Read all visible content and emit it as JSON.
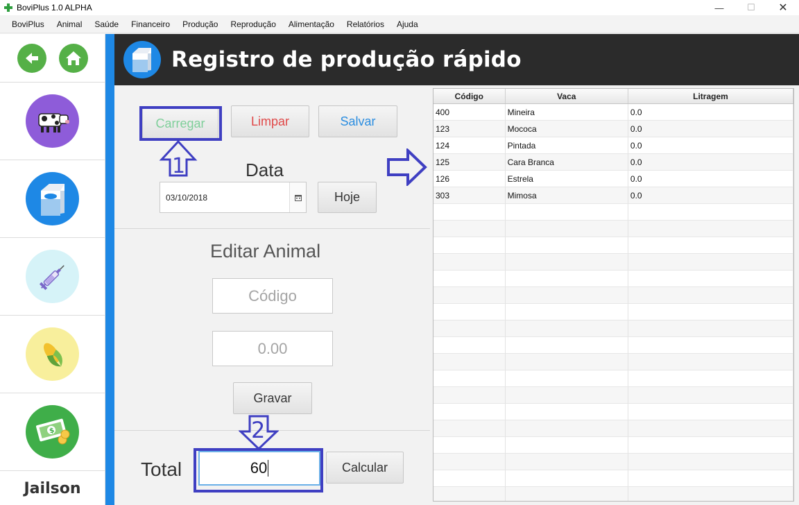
{
  "window": {
    "title": "BoviPlus 1.0 ALPHA"
  },
  "menu": [
    "BoviPlus",
    "Animal",
    "Saúde",
    "Financeiro",
    "Produção",
    "Reprodução",
    "Alimentação",
    "Relatórios",
    "Ajuda"
  ],
  "sidebar": {
    "back_icon": "arrow-left-icon",
    "home_icon": "home-icon",
    "items": [
      {
        "name": "cow",
        "icon": "cow-icon",
        "color": "#8e5cd9"
      },
      {
        "name": "milk",
        "icon": "milk-carton-icon",
        "color": "#1e88e5"
      },
      {
        "name": "health",
        "icon": "syringe-icon",
        "color": "#d6f3f8"
      },
      {
        "name": "feed",
        "icon": "corn-icon",
        "color": "#f8ef9c"
      },
      {
        "name": "finance",
        "icon": "money-icon",
        "color": "#3fae49"
      }
    ],
    "user": "Jailson"
  },
  "header": {
    "title": "Registro de produção rápido"
  },
  "form": {
    "load_label": "Carregar",
    "clear_label": "Limpar",
    "save_label": "Salvar",
    "date_label": "Data",
    "date_value": "03/10/2018",
    "today_label": "Hoje",
    "edit_title": "Editar Animal",
    "code_placeholder": "Código",
    "amount_placeholder": "0.00",
    "record_label": "Gravar",
    "total_label": "Total",
    "total_value": "60",
    "calc_label": "Calcular"
  },
  "annotations": {
    "one": "1",
    "two": "2"
  },
  "table": {
    "headers": [
      "Código",
      "Vaca",
      "Litragem"
    ],
    "rows": [
      [
        "400",
        "Mineira",
        "0.0"
      ],
      [
        "123",
        "Mococa",
        "0.0"
      ],
      [
        "124",
        "Pintada",
        "0.0"
      ],
      [
        "125",
        "Cara Branca",
        "0.0"
      ],
      [
        "126",
        "Estrela",
        "0.0"
      ],
      [
        "303",
        "Mimosa",
        "0.0"
      ]
    ]
  },
  "colors": {
    "accent": "#1e88e5",
    "header_bg": "#2b2b2b",
    "annotation": "#3f3fc2",
    "load": "#7fcf9a",
    "clear": "#e04848",
    "save": "#2a8de0"
  }
}
